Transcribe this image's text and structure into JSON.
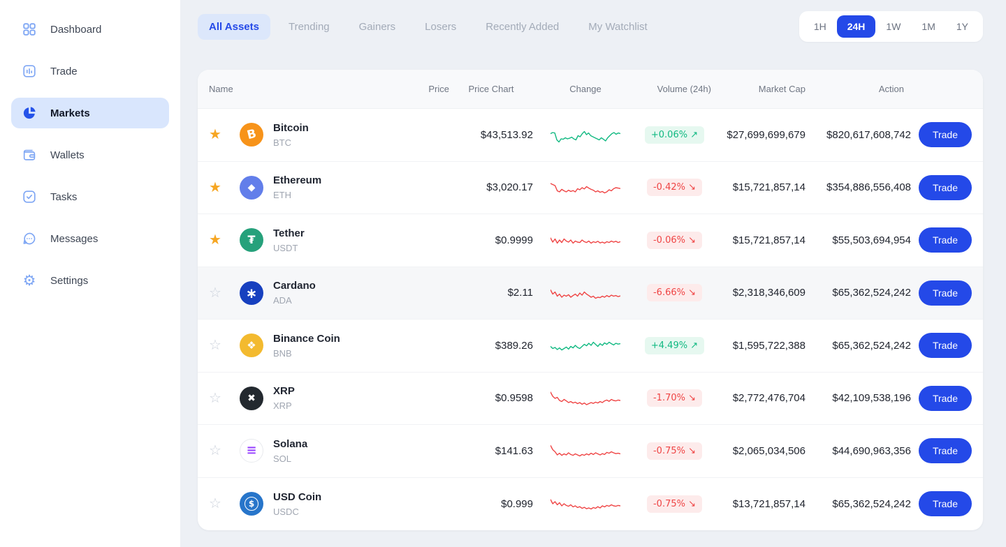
{
  "colors": {
    "accent_blue": "#2449E8",
    "green": "#10B981",
    "red": "#EF4444",
    "gold": "#F6A623",
    "sidebar_icon_blue": "#7EA6F4",
    "selected_item_bg": "#D9E6FD"
  },
  "icons": {
    "up_arrow": "↗",
    "down_arrow": "↘",
    "star_filled": "★",
    "star_outline": "☆"
  },
  "sidebar": {
    "items": [
      {
        "label": "Dashboard",
        "icon": "dashboard-icon",
        "active": false
      },
      {
        "label": "Trade",
        "icon": "trade-icon",
        "active": false
      },
      {
        "label": "Markets",
        "icon": "markets-pie-icon",
        "active": true
      },
      {
        "label": "Wallets",
        "icon": "wallets-icon",
        "active": false
      },
      {
        "label": "Tasks",
        "icon": "tasks-icon",
        "active": false
      },
      {
        "label": "Messages",
        "icon": "messages-icon",
        "active": false
      },
      {
        "label": "Settings",
        "icon": "settings-gear-icon",
        "active": false
      }
    ]
  },
  "tabs": {
    "items": [
      {
        "label": "All Assets",
        "active": true
      },
      {
        "label": "Trending",
        "active": false
      },
      {
        "label": "Gainers",
        "active": false
      },
      {
        "label": "Losers",
        "active": false
      },
      {
        "label": "Recently Added",
        "active": false
      },
      {
        "label": "My Watchlist",
        "active": false
      }
    ]
  },
  "time_ranges": {
    "items": [
      {
        "label": "1H",
        "active": false
      },
      {
        "label": "24H",
        "active": true
      },
      {
        "label": "1W",
        "active": false
      },
      {
        "label": "1M",
        "active": false
      },
      {
        "label": "1Y",
        "active": false
      }
    ]
  },
  "table": {
    "trade_label": "Trade",
    "columns": [
      {
        "label": "Name",
        "align": "left"
      },
      {
        "label": "Price",
        "align": "right"
      },
      {
        "label": "Price Chart",
        "align": "center"
      },
      {
        "label": "Change",
        "align": "center"
      },
      {
        "label": "Volume (24h)",
        "align": "right"
      },
      {
        "label": "Market Cap",
        "align": "right"
      },
      {
        "label": "Action",
        "align": "action"
      }
    ],
    "rows": [
      {
        "name": "Bitcoin",
        "symbol": "BTC",
        "price": "$43,513.92",
        "change": "+0.06%",
        "trend": "up",
        "volume": "$27,699,699,679",
        "market_cap": "$820,617,608,742",
        "starred": true,
        "highlighted": false,
        "icon": {
          "bg": "#F7931A",
          "color": "#FFFFFF",
          "glyph": "B",
          "size": 17,
          "tilt": true
        },
        "spark": [
          55,
          60,
          58,
          25,
          15,
          30,
          28,
          35,
          30,
          33,
          38,
          30,
          25,
          45,
          40,
          55,
          65,
          50,
          58,
          45,
          40,
          35,
          30,
          25,
          35,
          28,
          20,
          35,
          45,
          55,
          60,
          52,
          58,
          55
        ]
      },
      {
        "name": "Ethereum",
        "symbol": "ETH",
        "price": "$3,020.17",
        "change": "-0.42%",
        "trend": "down",
        "volume": "$15,721,857,14",
        "market_cap": "$354,886,556,408",
        "starred": true,
        "highlighted": false,
        "icon": {
          "bg": "#627EEA",
          "color": "#FFFFFF",
          "glyph": "◆",
          "size": 14
        },
        "spark": [
          70,
          65,
          60,
          35,
          30,
          42,
          35,
          30,
          38,
          32,
          36,
          30,
          45,
          40,
          50,
          44,
          55,
          48,
          42,
          38,
          30,
          35,
          28,
          32,
          25,
          30,
          40,
          35,
          45,
          50,
          48,
          46
        ]
      },
      {
        "name": "Tether",
        "symbol": "USDT",
        "price": "$0.9999",
        "change": "-0.06%",
        "trend": "down",
        "volume": "$15,721,857,14",
        "market_cap": "$55,503,694,954",
        "starred": true,
        "highlighted": false,
        "icon": {
          "bg": "#26A17B",
          "color": "#FFFFFF",
          "glyph": "₮",
          "size": 16
        },
        "spark": [
          60,
          40,
          55,
          35,
          50,
          38,
          55,
          45,
          40,
          50,
          35,
          45,
          40,
          38,
          50,
          42,
          38,
          45,
          35,
          42,
          38,
          44,
          36,
          40,
          35,
          42,
          38,
          45,
          40,
          44,
          38,
          42
        ]
      },
      {
        "name": "Cardano",
        "symbol": "ADA",
        "price": "$2.11",
        "change": "-6.66%",
        "trend": "down",
        "volume": "$2,318,346,609",
        "market_cap": "$65,362,524,242",
        "starred": false,
        "highlighted": true,
        "icon": {
          "bg": "#1740BF",
          "color": "#FFFFFF",
          "glyph": "∗",
          "size": 20
        },
        "spark": [
          65,
          45,
          55,
          35,
          45,
          30,
          40,
          35,
          42,
          30,
          38,
          45,
          35,
          50,
          40,
          55,
          45,
          38,
          30,
          35,
          25,
          30,
          28,
          35,
          30,
          38,
          32,
          40,
          35,
          38,
          33,
          36
        ]
      },
      {
        "name": "Binance Coin",
        "symbol": "BNB",
        "price": "$389.26",
        "change": "+4.49%",
        "trend": "up",
        "volume": "$1,595,722,388",
        "market_cap": "$65,362,524,242",
        "starred": false,
        "highlighted": false,
        "icon": {
          "bg": "#F3BA2F",
          "color": "#FFFFFF",
          "glyph": "❖",
          "size": 15
        },
        "spark": [
          45,
          35,
          40,
          30,
          38,
          28,
          35,
          42,
          32,
          45,
          38,
          50,
          40,
          35,
          45,
          55,
          48,
          60,
          50,
          65,
          55,
          45,
          58,
          50,
          62,
          55,
          65,
          58,
          52,
          60,
          56,
          58
        ]
      },
      {
        "name": "XRP",
        "symbol": "XRP",
        "price": "$0.9598",
        "change": "-1.70%",
        "trend": "down",
        "volume": "$2,772,476,704",
        "market_cap": "$42,109,538,196",
        "starred": false,
        "highlighted": false,
        "icon": {
          "bg": "#23292F",
          "color": "#FFFFFF",
          "glyph": "✖",
          "size": 14
        },
        "spark": [
          80,
          60,
          50,
          55,
          40,
          35,
          45,
          38,
          30,
          35,
          28,
          32,
          25,
          30,
          22,
          28,
          20,
          25,
          30,
          26,
          32,
          28,
          35,
          30,
          38,
          42,
          36,
          45,
          40,
          38,
          42,
          40
        ]
      },
      {
        "name": "Solana",
        "symbol": "SOL",
        "price": "$141.63",
        "change": "-0.75%",
        "trend": "down",
        "volume": "$2,065,034,506",
        "market_cap": "$44,690,963,356",
        "starred": false,
        "highlighted": false,
        "icon": {
          "bg": "#FFFFFF",
          "color": "#9945FF",
          "glyph": "≡",
          "size": 18,
          "border": "#E8EAEE"
        },
        "spark": [
          75,
          55,
          45,
          30,
          38,
          28,
          35,
          30,
          40,
          32,
          28,
          35,
          30,
          25,
          32,
          28,
          35,
          30,
          38,
          32,
          40,
          35,
          30,
          36,
          32,
          42,
          38,
          45,
          40,
          36,
          38,
          35
        ]
      },
      {
        "name": "USD Coin",
        "symbol": "USDC",
        "price": "$0.999",
        "change": "-0.75%",
        "trend": "down",
        "volume": "$13,721,857,14",
        "market_cap": "$65,362,524,242",
        "starred": false,
        "highlighted": false,
        "icon": {
          "bg": "#2775CA",
          "color": "#FFFFFF",
          "glyph": "$",
          "size": 12,
          "ring": true
        },
        "spark": [
          70,
          50,
          60,
          45,
          55,
          40,
          50,
          42,
          38,
          45,
          35,
          40,
          32,
          36,
          28,
          33,
          26,
          30,
          25,
          32,
          28,
          36,
          30,
          40,
          35,
          42,
          38,
          45,
          40,
          38,
          42,
          40
        ]
      }
    ]
  }
}
